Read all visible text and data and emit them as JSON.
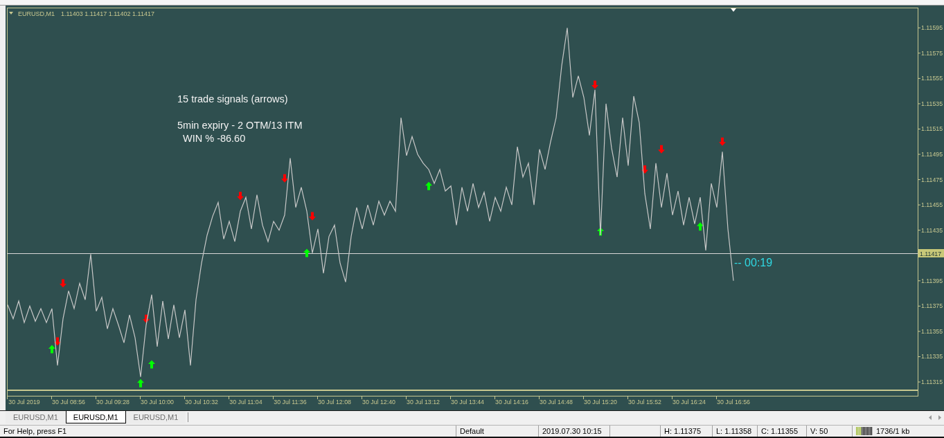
{
  "chart": {
    "symbol": "EURUSD,M1",
    "quote": "1.11403 1.11417 1.11402 1.11417",
    "notes": [
      "15 trade signals (arrows)",
      "5min expiry - 2 OTM/13 ITM",
      "WIN % -86.60"
    ],
    "countdown": "-- 00:19",
    "chart_data": {
      "type": "line",
      "ylim": [
        1.11309,
        1.11611
      ],
      "categories": [
        null,
        null,
        null,
        "30 Jul 2019",
        null,
        null,
        null,
        null,
        null,
        null,
        null,
        "30 Jul 08:56",
        null,
        null,
        null,
        null,
        null,
        null,
        null,
        "30 Jul 09:28",
        null,
        null,
        null,
        null,
        null,
        null,
        null,
        "30 Jul 10:00",
        null,
        null,
        null,
        null,
        null,
        null,
        null,
        "30 Jul 10:32",
        null,
        null,
        null,
        null,
        null,
        null,
        null,
        "30 Jul 11:04",
        null,
        null,
        null,
        null,
        null,
        null,
        null,
        "30 Jul 11:36",
        null,
        null,
        null,
        null,
        null,
        null,
        null,
        "30 Jul 12:08",
        null,
        null,
        null,
        null,
        null,
        null,
        null,
        "30 Jul 12:40",
        null,
        null,
        null,
        null,
        null,
        null,
        null,
        "30 Jul 13:12",
        null,
        null,
        null,
        null,
        null,
        null,
        null,
        "30 Jul 13:44",
        null,
        null,
        null,
        null,
        null,
        null,
        null,
        "30 Jul 14:16",
        null,
        null,
        null,
        null,
        null,
        null,
        null,
        "30 Jul 14:48",
        null,
        null,
        null,
        null,
        null,
        null,
        null,
        "30 Jul 15:20",
        null,
        null,
        null,
        null,
        null,
        null,
        null,
        "30 Jul 15:52",
        null,
        null,
        null,
        null,
        null,
        null,
        null,
        "30 Jul 16:24",
        null,
        null,
        null,
        null,
        null,
        null,
        null,
        "30 Jul 16:56"
      ],
      "yticks": [
        1.11595,
        1.11575,
        1.11555,
        1.11535,
        1.11515,
        1.11495,
        1.11475,
        1.11455,
        1.11435,
        1.11395,
        1.11375,
        1.11355,
        1.11335,
        1.11315
      ],
      "series": [
        {
          "color": "#c8c8c8",
          "values": [
            1.11376,
            1.11365,
            1.11379,
            1.11362,
            1.11375,
            1.11363,
            1.11373,
            1.11362,
            1.11373,
            1.11328,
            1.11365,
            1.11387,
            1.11373,
            1.11393,
            1.1138,
            1.11416,
            1.11371,
            1.11382,
            1.11357,
            1.11373,
            1.1136,
            1.11346,
            1.11368,
            1.1135,
            1.11319,
            1.1136,
            1.11384,
            1.11343,
            1.11379,
            1.11349,
            1.11376,
            1.1135,
            1.11372,
            1.11328,
            1.1138,
            1.11409,
            1.11431,
            1.11446,
            1.11457,
            1.11428,
            1.11442,
            1.11426,
            1.1145,
            1.11461,
            1.11436,
            1.11463,
            1.11439,
            1.11426,
            1.11442,
            1.11435,
            1.11447,
            1.11492,
            1.11453,
            1.11469,
            1.1145,
            1.11417,
            1.11436,
            1.11401,
            1.1143,
            1.11439,
            1.11409,
            1.11394,
            1.1143,
            1.11453,
            1.11436,
            1.11455,
            1.11439,
            1.11458,
            1.11447,
            1.11458,
            1.1145,
            1.11524,
            1.11494,
            1.11509,
            1.11495,
            1.11488,
            1.11483,
            1.11472,
            1.11483,
            1.11466,
            1.1147,
            1.11439,
            1.11469,
            1.1145,
            1.11472,
            1.11453,
            1.11465,
            1.11442,
            1.11461,
            1.1145,
            1.11469,
            1.11455,
            1.11501,
            1.11477,
            1.11488,
            1.11455,
            1.11499,
            1.11483,
            1.11505,
            1.11524,
            1.11565,
            1.11595,
            1.1154,
            1.11557,
            1.1154,
            1.1151,
            1.11546,
            1.11431,
            1.11535,
            1.115,
            1.11477,
            1.11524,
            1.11486,
            1.11541,
            1.1152,
            1.11464,
            1.11436,
            1.11488,
            1.11453,
            1.1148,
            1.11447,
            1.11466,
            1.11439,
            1.11461,
            1.1144,
            1.11461,
            1.11419,
            1.11472,
            1.11453,
            1.11497,
            1.11436,
            1.11395
          ]
        },
        {
          "type": "scatter",
          "color": "#ff0000",
          "values": [
            null,
            null,
            null,
            null,
            null,
            null,
            null,
            null,
            null,
            1.11347,
            1.11393,
            null,
            null,
            null,
            null,
            null,
            null,
            null,
            null,
            null,
            null,
            null,
            null,
            null,
            null,
            1.11365,
            null,
            null,
            null,
            null,
            null,
            null,
            null,
            null,
            null,
            null,
            null,
            null,
            null,
            null,
            null,
            null,
            1.11462,
            null,
            null,
            null,
            null,
            null,
            null,
            null,
            1.11476,
            null,
            null,
            null,
            null,
            1.11446,
            null,
            null,
            null,
            null,
            null,
            null,
            null,
            null,
            null,
            null,
            null,
            null,
            null,
            null,
            null,
            null,
            null,
            null,
            null,
            null,
            null,
            null,
            null,
            null,
            null,
            null,
            null,
            null,
            null,
            null,
            null,
            null,
            null,
            null,
            null,
            null,
            null,
            null,
            null,
            null,
            null,
            null,
            null,
            null,
            null,
            null,
            null,
            null,
            null,
            null,
            1.1155,
            null,
            null,
            null,
            null,
            null,
            null,
            null,
            null,
            1.11483,
            null,
            null,
            1.11499,
            null,
            null,
            null,
            null,
            null,
            null,
            null,
            null,
            null,
            null,
            1.11505,
            null,
            null
          ]
        },
        {
          "type": "scatter",
          "color": "#00ff00",
          "values": [
            null,
            null,
            null,
            null,
            null,
            null,
            null,
            null,
            1.11341,
            null,
            null,
            null,
            null,
            null,
            null,
            null,
            null,
            null,
            null,
            null,
            null,
            null,
            null,
            null,
            1.11314,
            null,
            1.11329,
            null,
            null,
            null,
            null,
            null,
            null,
            null,
            null,
            null,
            null,
            null,
            null,
            null,
            null,
            null,
            null,
            null,
            null,
            null,
            null,
            null,
            null,
            null,
            null,
            null,
            null,
            null,
            1.11417,
            null,
            null,
            null,
            null,
            null,
            null,
            null,
            null,
            null,
            null,
            null,
            null,
            null,
            null,
            null,
            null,
            null,
            null,
            null,
            null,
            null,
            1.1147,
            null,
            null,
            null,
            null,
            null,
            null,
            null,
            null,
            null,
            null,
            null,
            null,
            null,
            null,
            null,
            null,
            null,
            null,
            null,
            null,
            null,
            null,
            null,
            null,
            null,
            null,
            null,
            null,
            null,
            null,
            1.11434,
            null,
            null,
            null,
            null,
            null,
            null,
            null,
            null,
            null,
            null,
            null,
            null,
            null,
            null,
            null,
            null,
            null,
            1.11438,
            null,
            null,
            null,
            null,
            null,
            null
          ]
        }
      ],
      "ref_lines": [
        {
          "axis": "y",
          "value": 1.11417,
          "label": "1.11417"
        }
      ]
    }
  },
  "tabs": [
    {
      "label": "EURUSD,M1",
      "selected": false
    },
    {
      "label": "EURUSD,M1",
      "selected": true
    },
    {
      "label": "EURUSD,M1",
      "selected": false
    }
  ],
  "status_bar": {
    "help": "For Help, press F1",
    "profile": "Default",
    "bar_time": "2019.07.30 10:15",
    "high": "H: 1.11375",
    "low": "L: 1.11358",
    "close": "C: 1.11355",
    "volume": "V: 50",
    "traffic": "1736/1 kb"
  }
}
